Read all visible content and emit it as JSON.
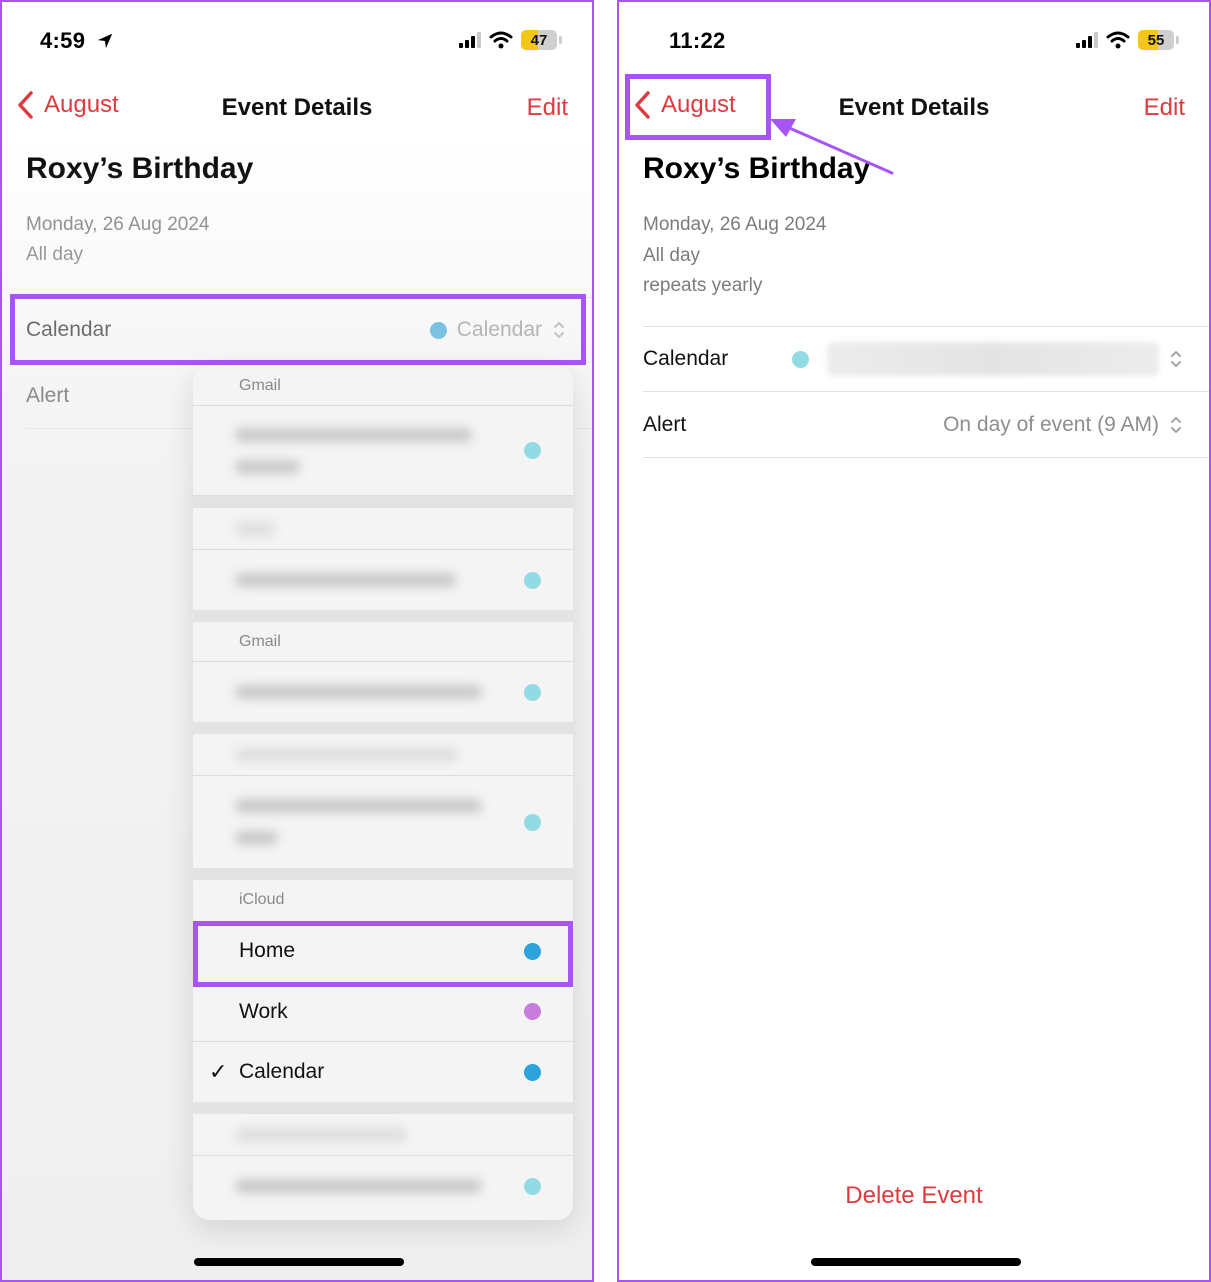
{
  "colors": {
    "accent_red": "#e0393e",
    "annotation_purple": "#a855f7",
    "calendar_blue": "#2ba3dc",
    "gmail_teal": "#93dbe4",
    "work_purple": "#c77ddc",
    "battery_yellow": "#f5c518"
  },
  "left": {
    "status": {
      "time": "4:59",
      "battery": "47",
      "battery_level_percent": 47,
      "location_icon": "location-arrow-icon",
      "signal_bars": 3,
      "wifi": true
    },
    "nav": {
      "back_label": "August",
      "title": "Event Details",
      "edit_label": "Edit"
    },
    "event": {
      "title": "Roxy’s Birthday",
      "date": "Monday, 26 Aug 2024",
      "time": "All day"
    },
    "rows": {
      "calendar": {
        "label": "Calendar",
        "value": "Calendar"
      },
      "alert": {
        "label": "Alert"
      }
    },
    "popup": {
      "sections": [
        {
          "header": "Gmail",
          "items_redacted": 2
        },
        {
          "header": "Gmail",
          "items_redacted": 2
        },
        {
          "header": "iCloud",
          "items": [
            {
              "label": "Home",
              "color": "#2ba3dc",
              "checked": false,
              "highlighted": true
            },
            {
              "label": "Work",
              "color": "#c77ddc",
              "checked": false
            },
            {
              "label": "Calendar",
              "color": "#2ba3dc",
              "checked": true
            }
          ]
        },
        {
          "header": "",
          "items_redacted": 1
        }
      ],
      "check_glyph": "✓"
    }
  },
  "right": {
    "status": {
      "time": "11:22",
      "battery": "55",
      "battery_level_percent": 55,
      "signal_bars": 3,
      "wifi": true
    },
    "nav": {
      "back_label": "August",
      "title": "Event Details",
      "edit_label": "Edit"
    },
    "event": {
      "title": "Roxy’s Birthday",
      "date": "Monday, 26 Aug 2024",
      "time": "All day",
      "repeat": "repeats yearly"
    },
    "rows": {
      "calendar": {
        "label": "Calendar",
        "value_redacted": true
      },
      "alert": {
        "label": "Alert",
        "value": "On day of event (9 AM)"
      }
    },
    "delete_label": "Delete Event"
  }
}
